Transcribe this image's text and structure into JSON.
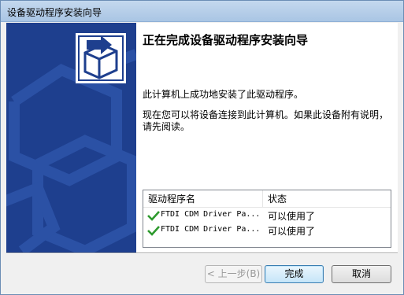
{
  "window": {
    "title": "设备驱动程序安装向导"
  },
  "content": {
    "heading": "正在完成设备驱动程序安装向导",
    "paragraph1": "此计算机上成功地安装了此驱动程序。",
    "paragraph2": "现在您可以将设备连接到此计算机。如果此设备附有说明，请先阅读。"
  },
  "driver_list": {
    "columns": [
      "驱动程序名",
      "状态"
    ],
    "rows": [
      {
        "name": "FTDI CDM Driver Pa...",
        "status": "可以使用了",
        "icon": "green-check-icon"
      },
      {
        "name": "FTDI CDM Driver Pa...",
        "status": "可以使用了",
        "icon": "green-check-icon"
      }
    ]
  },
  "buttons": {
    "back": "< 上一步(B)",
    "finish": "完成",
    "cancel": "取消"
  },
  "colors": {
    "banner": "#1e3f8e",
    "check": "#2e9a2e"
  }
}
